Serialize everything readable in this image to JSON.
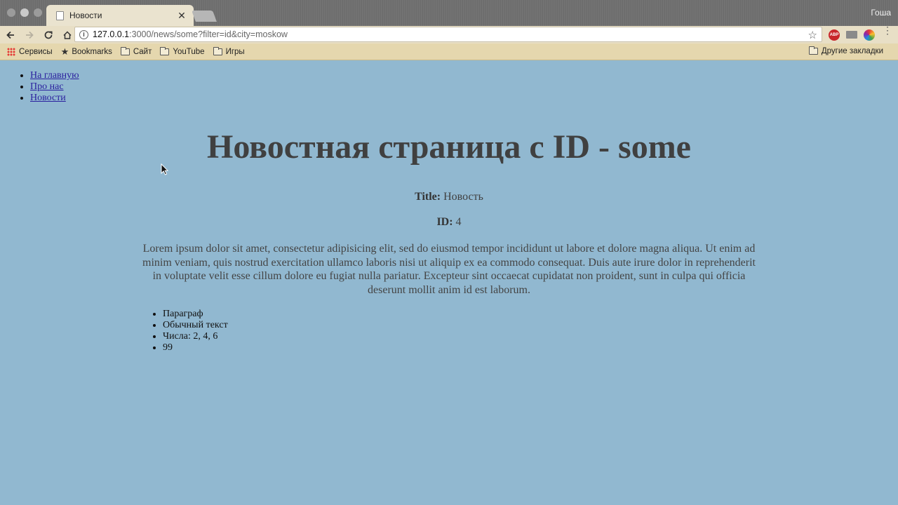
{
  "browser": {
    "tab_title": "Новости",
    "user_name": "Гоша",
    "url_host": "127.0.0.1",
    "url_rest": ":3000/news/some?filter=id&city=moskow",
    "bookmarks": {
      "apps": "Сервисы",
      "bookmarks": "Bookmarks",
      "site": "Сайт",
      "youtube": "YouTube",
      "games": "Игры",
      "other": "Другие закладки"
    },
    "extensions": {
      "abp_label": "ABP"
    }
  },
  "nav": [
    {
      "label": "На главную"
    },
    {
      "label": "Про нас"
    },
    {
      "label": "Новости"
    }
  ],
  "main": {
    "heading": "Новостная страница с ID - some",
    "title_label": "Title:",
    "title_value": "Новость",
    "id_label": "ID:",
    "id_value": "4",
    "lorem": "Lorem ipsum dolor sit amet, consectetur adipisicing elit, sed do eiusmod tempor incididunt ut labore et dolore magna aliqua. Ut enim ad minim veniam, quis nostrud exercitation ullamco laboris nisi ut aliquip ex ea commodo consequat. Duis aute irure dolor in reprehenderit in voluptate velit esse cillum dolore eu fugiat nulla pariatur. Excepteur sint occaecat cupidatat non proident, sunt in culpa qui officia deserunt mollit anim id est laborum.",
    "items": [
      {
        "text": "Параграф"
      },
      {
        "text": "Обычный текст"
      },
      {
        "text": "Числа: 2, 4, 6"
      },
      {
        "text": "99"
      }
    ]
  }
}
